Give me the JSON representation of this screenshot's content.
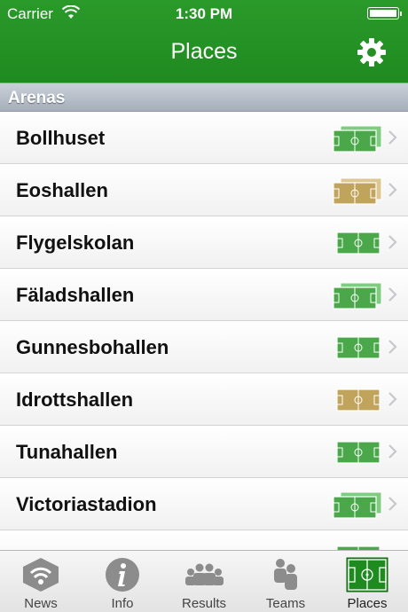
{
  "status_bar": {
    "carrier": "Carrier",
    "time": "1:30 PM"
  },
  "nav": {
    "title": "Places",
    "settings_icon": "gear-icon"
  },
  "section": {
    "title": "Arenas"
  },
  "rows": [
    {
      "label": "Bollhuset",
      "field_color": "#4aa84a",
      "fields": 2
    },
    {
      "label": "Eoshallen",
      "field_color": "#c1a45c",
      "fields": 2
    },
    {
      "label": "Flygelskolan",
      "field_color": "#4aa84a",
      "fields": 1
    },
    {
      "label": "Fäladshallen",
      "field_color": "#4aa84a",
      "fields": 2
    },
    {
      "label": "Gunnesbohallen",
      "field_color": "#4aa84a",
      "fields": 1
    },
    {
      "label": "Idrottshallen",
      "field_color": "#c1a45c",
      "fields": 1
    },
    {
      "label": "Tunahallen",
      "field_color": "#4aa84a",
      "fields": 1
    },
    {
      "label": "Victoriastadion",
      "field_color": "#4aa84a",
      "fields": 2
    }
  ],
  "tabs": [
    {
      "label": "News",
      "icon": "news-icon"
    },
    {
      "label": "Info",
      "icon": "info-icon"
    },
    {
      "label": "Results",
      "icon": "results-icon"
    },
    {
      "label": "Teams",
      "icon": "teams-icon"
    },
    {
      "label": "Places",
      "icon": "places-icon",
      "active": true
    }
  ],
  "colors": {
    "header_green": "#1f8a20",
    "green_field": "#4aa84a",
    "gold_field": "#c1a45c"
  }
}
